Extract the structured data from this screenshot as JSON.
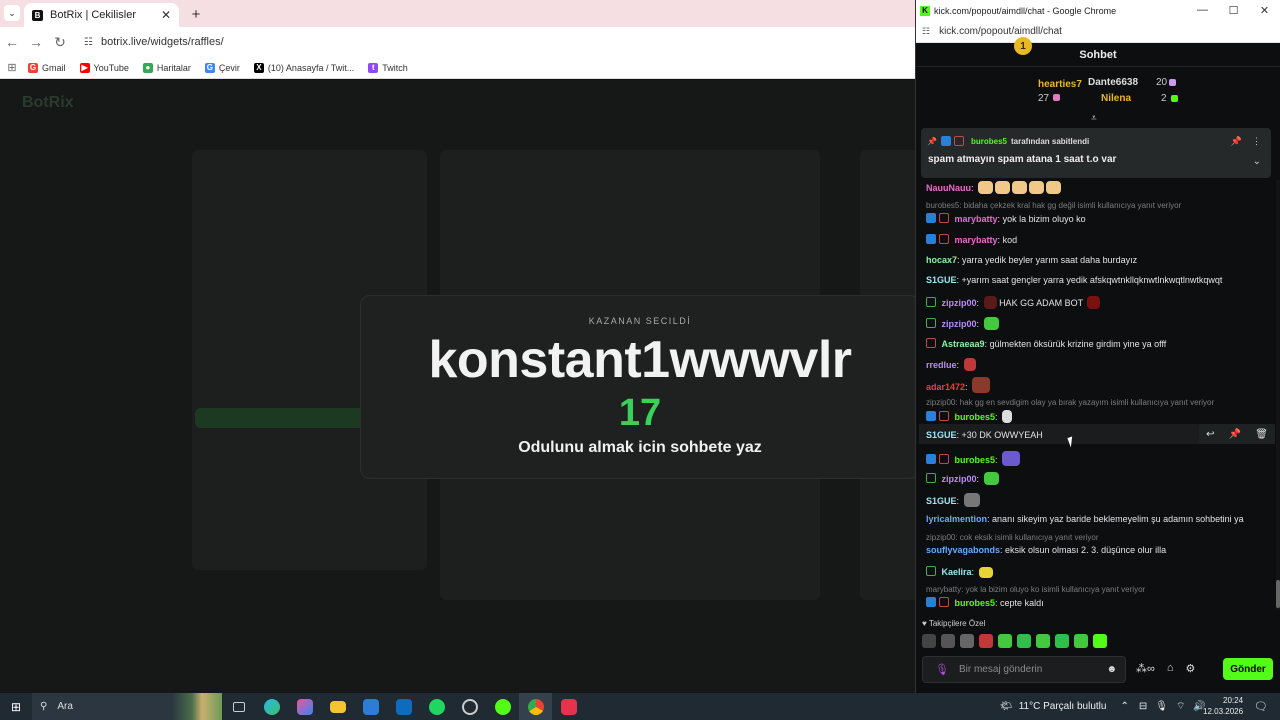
{
  "browser": {
    "tab_title": "BotRix | Cekilisler",
    "url": "botrix.live/widgets/raffles/",
    "bookmarks": [
      "Gmail",
      "YouTube",
      "Haritalar",
      "Çevir",
      "(10) Anasayfa / Twit...",
      "Twitch"
    ]
  },
  "page": {
    "logo": "BotRix",
    "winner_label": "KAZANAN SECILDİ",
    "winner_name": "konstant1wwwvlr",
    "winner_number": "17",
    "winner_subtitle": "Odulunu almak icin sohbete yaz"
  },
  "chat_window": {
    "title": "kick.com/popout/aimdll/chat - Google Chrome",
    "url": "kick.com/popout/aimdll/chat",
    "header": "Sohbet",
    "leaderboard": {
      "first_rank": "1",
      "first_name": "hearties7",
      "first_count": "27",
      "second_name": "Dante6638",
      "second_count": "20",
      "third_name": "Nilena",
      "third_count": "2"
    },
    "pinned": {
      "author": "burobes5",
      "by_text": "tarafından sabitlendi",
      "message": "spam atmayın spam atana 1 saat t.o var"
    },
    "messages": [
      {
        "user": "NauuNauu",
        "text": ""
      },
      {
        "reply": "burobes5: bidaha çekzek kral hak gg değil isimli kullanıcıya yanıt veriyor"
      },
      {
        "user": "marybatty",
        "text": "yok la bizim oluyo ko"
      },
      {
        "user": "marybatty",
        "text": "kod"
      },
      {
        "user": "hocax7",
        "text": "yarra yedik beyler yarım saat daha burdayız"
      },
      {
        "user": "S1GUE",
        "text": "+yarım saat gençler yarra yedik afskqwtnkllqknwtlnkwqtlnwtkqwqt"
      },
      {
        "user": "zipzip00",
        "text": "HAK GG ADAM BOT"
      },
      {
        "user": "zipzip00",
        "text": ""
      },
      {
        "user": "Astraeaa9",
        "text": "gülmekten öksürük krizine girdim yine ya offf"
      },
      {
        "user": "rredlue",
        "text": ""
      },
      {
        "user": "adar1472",
        "text": ""
      },
      {
        "reply": "zipzip00: hak gg en sevdigim olay ya bırak yazayım isimli kullanıcıya yanıt veriyor"
      },
      {
        "user": "burobes5",
        "text": ""
      },
      {
        "user": "S1GUE",
        "text": "+30 DK OWWYEAH"
      },
      {
        "user": "burobes5",
        "text": ""
      },
      {
        "user": "zipzip00",
        "text": ""
      },
      {
        "user": "S1GUE",
        "text": ""
      },
      {
        "user": "lyricalmention",
        "text": "ananı sikeyim yaz baride beklemeyelim şu adamın sohbetini ya"
      },
      {
        "reply": "zipzip00: cok eksik isimli kullanıcıya yanıt veriyor"
      },
      {
        "user": "souflyvagabonds",
        "text": "eksik olsun olması 2. 3. düşünce olur illa"
      },
      {
        "user": "Kaelira",
        "text": ""
      },
      {
        "reply": "marybatty: yok la bizim oluyo ko isimli kullanıcıya yanıt veriyor"
      },
      {
        "user": "burobes5",
        "text": "cepte kaldı"
      }
    ],
    "subscribers_label": "Takipçilere Özel",
    "input_placeholder": "Bir mesaj gönderin",
    "send_label": "Gönder"
  },
  "taskbar": {
    "search_label": "Ara",
    "weather": "11°C  Parçalı bulutlu",
    "time": "20:24",
    "date": "12.03.2026"
  },
  "colors": {
    "kick_green": "#53fc18",
    "winner_number": "#3ad15a",
    "chat_bg": "#0d0e0f"
  }
}
